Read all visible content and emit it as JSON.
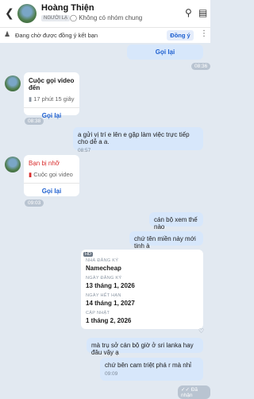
{
  "header": {
    "name": "Hoàng Thiện",
    "badge": "NGƯỜI LẠ",
    "not_common_group": "Không có nhóm chung"
  },
  "banner": {
    "text": "Đang chờ được đồng ý kết bạn",
    "accept_label": "Đồng ý"
  },
  "messages": {
    "top_retry": "Gọi lại",
    "top_time": "08:36",
    "video_call": {
      "title": "Cuộc gọi video đến",
      "duration": "17 phút 15 giây",
      "retry": "Gọi lại",
      "time": "08:38"
    },
    "msg1": {
      "text": "a gửi vị trí e lên e gặp làm việc trực tiếp cho dễ a a.",
      "time": "08:57"
    },
    "missed_call": {
      "title": "Bạn bị nhỡ",
      "sub": "Cuộc gọi video",
      "retry": "Gọi lại",
      "time": "09:03"
    },
    "msg2": {
      "text": "cán bộ xem thế nào"
    },
    "msg3": {
      "text": "chứ tên miền này mới tinh à"
    },
    "domain_card": {
      "tag": "HD",
      "registrar_label": "NHÀ ĐĂNG KÝ",
      "registrar": "Namecheap",
      "registered_label": "NGÀY ĐĂNG KÝ",
      "registered": "13 tháng 1, 2026",
      "expiry_label": "NGÀY HẾT HẠN",
      "expiry": "14 tháng 1, 2027",
      "updated_label": "CẬP NHẬT",
      "updated": "1 tháng 2, 2026"
    },
    "msg4": {
      "text": "mà trụ sở cán bộ giờ ở sri lanka hay đâu vậy ạ"
    },
    "msg5": {
      "text": "chứ bên cam triệt phá r mà nhỉ",
      "time": "09:09"
    },
    "received": "Đã nhận"
  }
}
